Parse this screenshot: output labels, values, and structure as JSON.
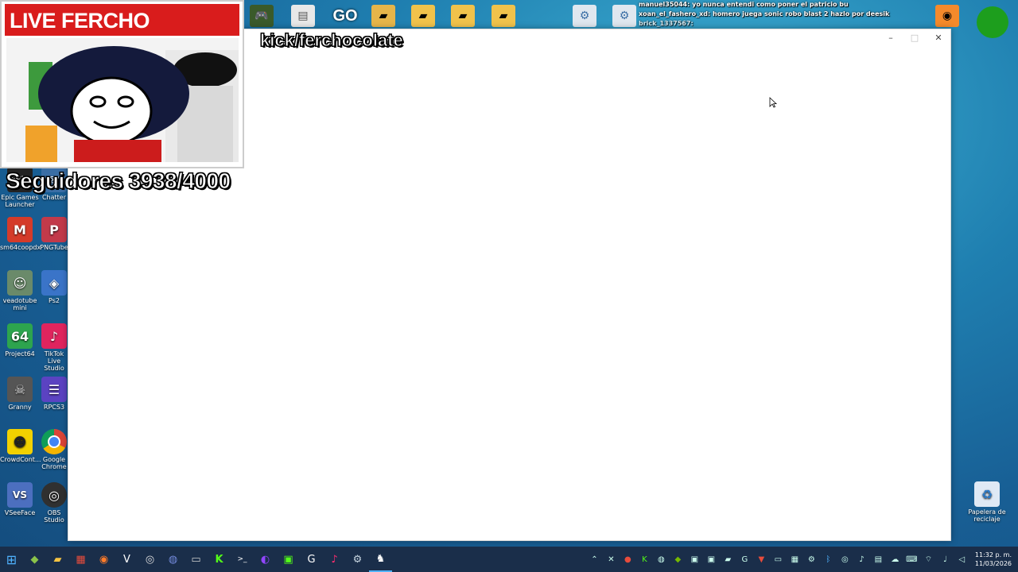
{
  "stream_overlay": {
    "title": "LIVE FERCHO REACTION",
    "channel": "kick/ferchocolate",
    "followers": "Seguidores 3938/4000",
    "go_badge": "GO"
  },
  "chat": {
    "messages": [
      "manuel35044: yo nunca entendi como poner el patricio bu",
      "xoan_el_fashero_xd: homero juega sonic robo blast 2 hazlo por deesik",
      "brick_1337567:"
    ]
  },
  "desktop_icons": [
    {
      "label": "Epic Games Launcher",
      "icon": "epic-icon",
      "color": "#222222"
    },
    {
      "label": "Chatter",
      "icon": "chatter-icon",
      "color": "#3a6ea5"
    },
    {
      "label": "sm64coopdx",
      "icon": "mario-icon",
      "color": "#d43b2a"
    },
    {
      "label": "PNGTube",
      "icon": "pngtube-icon",
      "color": "#c23a4a"
    },
    {
      "label": "veadotube mini",
      "icon": "veadotube-icon",
      "color": "#6a8a6a"
    },
    {
      "label": "Ps2",
      "icon": "ps2-icon",
      "color": "#3a74c8"
    },
    {
      "label": "Project64",
      "icon": "project64-icon",
      "color": "#2da44e"
    },
    {
      "label": "TikTok Live Studio",
      "icon": "tiktok-icon",
      "color": "#e0245e"
    },
    {
      "label": "Granny",
      "icon": "granny-icon",
      "color": "#555555"
    },
    {
      "label": "RPCS3",
      "icon": "rpcs3-icon",
      "color": "#5b43c2"
    },
    {
      "label": "CrowdCont...",
      "icon": "crowdcontrol-icon",
      "color": "#f2d100"
    },
    {
      "label": "Google Chrome",
      "icon": "chrome-icon",
      "color": "#ffffff"
    },
    {
      "label": "VSeeFace",
      "icon": "vseeface-icon",
      "color": "#4c6fbf"
    },
    {
      "label": "OBS Studio",
      "icon": "obs-icon",
      "color": "#303030"
    },
    {
      "label": "Papelera de reciclaje",
      "icon": "recycle-bin-icon",
      "color": "#dfe9f5"
    }
  ],
  "window": {
    "minimize": "–",
    "maximize": "□",
    "close": "✕"
  },
  "taskbar": {
    "clock_time": "11:32 p. m.",
    "clock_date": "11/03/2026"
  }
}
